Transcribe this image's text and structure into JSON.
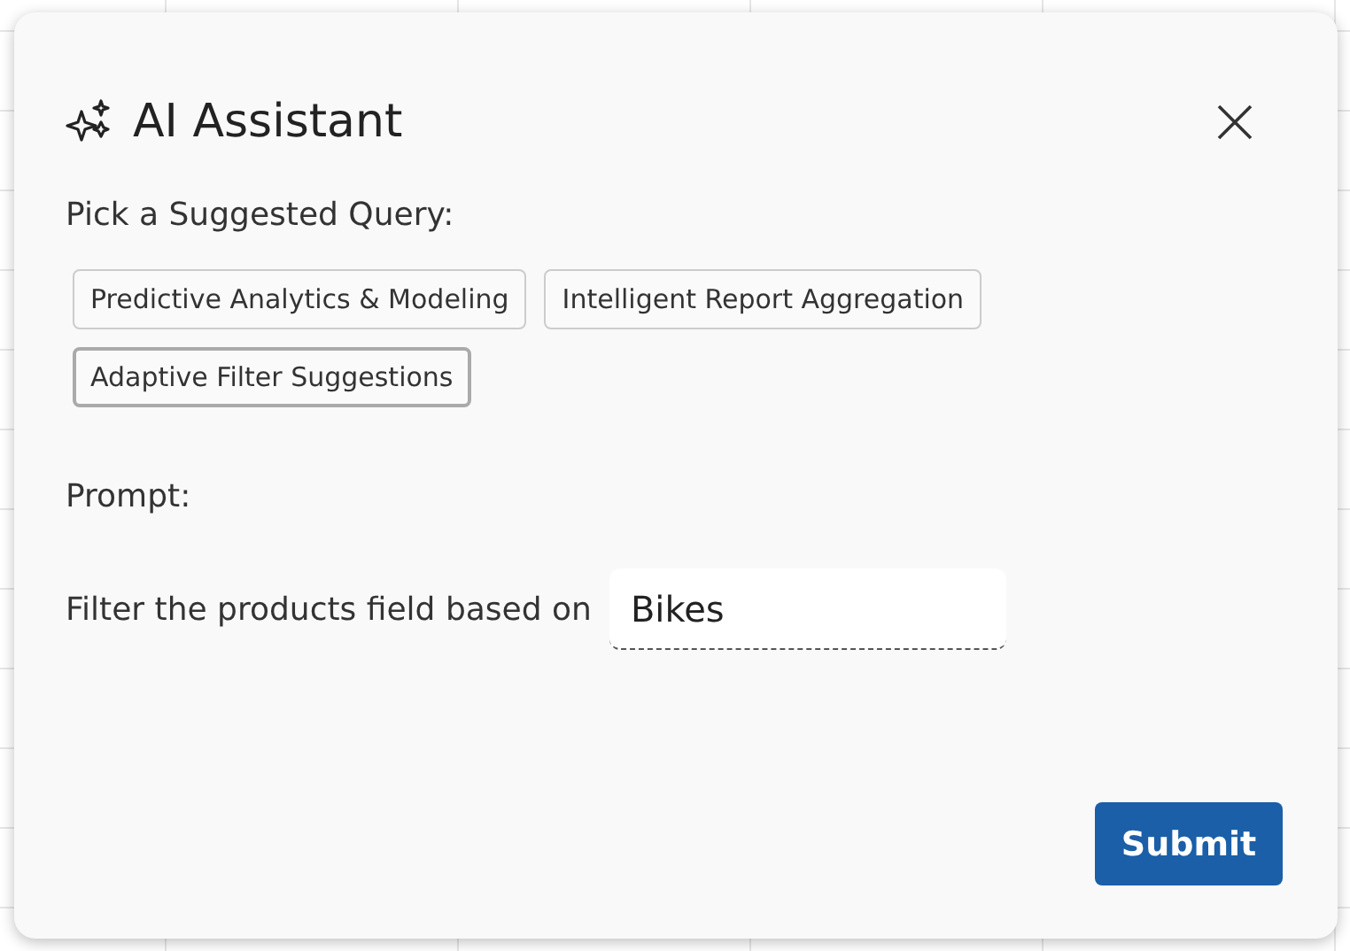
{
  "dialog": {
    "title": "AI Assistant",
    "suggestions_label": "Pick a Suggested Query:",
    "suggestions": [
      {
        "label": "Predictive Analytics & Modeling",
        "selected": false
      },
      {
        "label": "Intelligent Report Aggregation",
        "selected": false
      },
      {
        "label": "Adaptive Filter Suggestions",
        "selected": true
      }
    ],
    "prompt_label": "Prompt:",
    "prompt_text": "Filter the products field based on",
    "prompt_value": "Bikes",
    "submit": "Submit"
  }
}
